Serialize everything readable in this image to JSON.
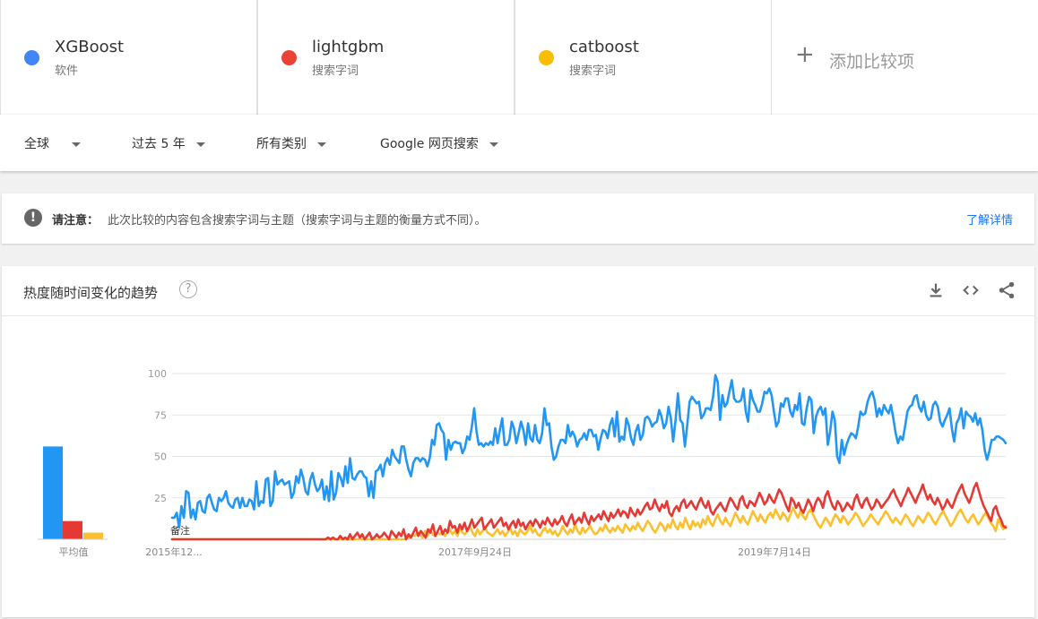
{
  "compare": {
    "terms": [
      {
        "name": "XGBoost",
        "sub": "软件",
        "color": "#4285f4"
      },
      {
        "name": "lightgbm",
        "sub": "搜索字词",
        "color": "#ea4335"
      },
      {
        "name": "catboost",
        "sub": "搜索字词",
        "color": "#fbbc04"
      }
    ],
    "add_label": "添加比较项"
  },
  "filters": {
    "region": "全球",
    "time": "过去 5 年",
    "category": "所有类别",
    "search_type": "Google 网页搜索"
  },
  "notice": {
    "title": "请注意：",
    "text": "此次比较的内容包含搜索字词与主题（搜索字词与主题的衡量方式不同）。",
    "link": "了解详情"
  },
  "card": {
    "title": "热度随时间变化的趋势",
    "icons": [
      "download-icon",
      "embed-code-icon",
      "share-icon"
    ]
  },
  "chart_data": {
    "type": "line",
    "yticks": [
      25,
      50,
      75,
      100
    ],
    "ylim": [
      0,
      100
    ],
    "xtick_labels": [
      "2015年12...",
      "2017年9月24日",
      "2019年7月14日"
    ],
    "note_label": "备注",
    "average_label": "平均值",
    "averages": [
      {
        "name": "XGBoost",
        "value": 56
      },
      {
        "name": "lightgbm",
        "value": 11
      },
      {
        "name": "catboost",
        "value": 4
      }
    ],
    "series": [
      {
        "name": "XGBoost",
        "color": "#2196f3",
        "values": [
          13,
          13,
          16,
          7,
          20,
          13,
          29,
          28,
          13,
          18,
          12,
          22,
          23,
          17,
          16,
          25,
          27,
          22,
          18,
          17,
          25,
          23,
          25,
          29,
          22,
          20,
          19,
          24,
          25,
          19,
          25,
          20,
          20,
          24,
          23,
          18,
          35,
          20,
          23,
          22,
          36,
          37,
          20,
          23,
          41,
          33,
          35,
          36,
          33,
          34,
          35,
          25,
          28,
          38,
          34,
          42,
          37,
          29,
          27,
          36,
          40,
          33,
          29,
          31,
          36,
          24,
          32,
          23,
          41,
          24,
          28,
          40,
          37,
          32,
          44,
          34,
          49,
          37,
          36,
          39,
          41,
          41,
          38,
          37,
          26,
          35,
          25,
          41,
          42,
          45,
          38,
          46,
          49,
          45,
          54,
          50,
          48,
          46,
          56,
          56,
          48,
          42,
          38,
          46,
          49,
          49,
          47,
          49,
          48,
          44,
          49,
          60,
          57,
          69,
          70,
          66,
          64,
          48,
          60,
          54,
          58,
          59,
          58,
          58,
          52,
          55,
          62,
          60,
          68,
          79,
          65,
          57,
          58,
          56,
          58,
          57,
          59,
          57,
          67,
          58,
          66,
          73,
          57,
          57,
          60,
          71,
          67,
          58,
          64,
          71,
          66,
          57,
          70,
          61,
          59,
          69,
          60,
          58,
          64,
          79,
          69,
          70,
          56,
          48,
          50,
          56,
          60,
          60,
          58,
          69,
          62,
          65,
          62,
          56,
          60,
          61,
          64,
          60,
          66,
          66,
          62,
          63,
          54,
          61,
          66,
          65,
          61,
          69,
          73,
          62,
          77,
          59,
          62,
          60,
          73,
          69,
          61,
          57,
          65,
          69,
          60,
          63,
          73,
          74,
          72,
          68,
          70,
          71,
          78,
          74,
          67,
          70,
          80,
          73,
          59,
          72,
          88,
          72,
          70,
          56,
          69,
          83,
          86,
          84,
          82,
          83,
          73,
          75,
          79,
          79,
          78,
          86,
          99,
          95,
          72,
          87,
          80,
          82,
          89,
          96,
          85,
          83,
          83,
          84,
          91,
          77,
          71,
          90,
          84,
          81,
          77,
          77,
          82,
          89,
          88,
          91,
          87,
          77,
          68,
          71,
          82,
          80,
          85,
          85,
          77,
          74,
          81,
          78,
          88,
          70,
          69,
          79,
          86,
          84,
          64,
          74,
          78,
          80,
          75,
          79,
          57,
          65,
          77,
          72,
          50,
          46,
          60,
          51,
          57,
          61,
          64,
          63,
          61,
          68,
          77,
          75,
          76,
          83,
          87,
          89,
          84,
          74,
          79,
          75,
          81,
          78,
          76,
          81,
          73,
          64,
          58,
          62,
          60,
          68,
          77,
          80,
          81,
          86,
          87,
          80,
          77,
          83,
          75,
          72,
          73,
          81,
          83,
          80,
          71,
          68,
          72,
          75,
          79,
          67,
          59,
          70,
          73,
          79,
          67,
          77,
          75,
          74,
          71,
          76,
          69,
          73,
          66,
          54,
          48,
          53,
          60,
          60,
          62,
          62,
          61,
          60,
          58
        ]
      },
      {
        "name": "lightgbm",
        "color": "#e53935",
        "values": [
          0,
          0,
          0,
          0,
          0,
          0,
          0,
          0,
          0,
          0,
          0,
          0,
          0,
          0,
          0,
          0,
          0,
          0,
          0,
          0,
          0,
          0,
          0,
          0,
          0,
          0,
          0,
          0,
          0,
          0,
          0,
          0,
          0,
          0,
          0,
          0,
          0,
          0,
          0,
          0,
          0,
          0,
          0,
          0,
          0,
          0,
          0,
          0,
          0,
          0,
          0,
          0,
          0,
          0,
          0,
          0,
          0,
          0,
          0,
          0,
          0,
          0,
          0,
          0,
          1,
          0,
          1,
          0,
          0,
          2,
          0,
          1,
          0,
          3,
          0,
          2,
          4,
          1,
          3,
          0,
          2,
          4,
          0,
          1,
          3,
          1,
          2,
          4,
          2,
          0,
          5,
          3,
          1,
          4,
          2,
          6,
          0,
          3,
          1,
          4,
          7,
          2,
          5,
          3,
          1,
          6,
          4,
          9,
          2,
          5,
          8,
          3,
          6,
          4,
          11,
          7,
          8,
          4,
          9,
          6,
          10,
          5,
          8,
          12,
          7,
          9,
          11,
          13,
          6,
          8,
          10,
          12,
          7,
          9,
          11,
          13,
          8,
          10,
          6,
          9,
          11,
          7,
          12,
          8,
          10,
          6,
          9,
          11,
          8,
          12,
          10,
          7,
          11,
          9,
          13,
          10,
          8,
          12,
          9,
          11,
          14,
          10,
          8,
          12,
          15,
          9,
          11,
          13,
          10,
          16,
          12,
          9,
          14,
          11,
          13,
          15,
          12,
          17,
          14,
          11,
          16,
          13,
          15,
          18,
          14,
          17,
          16,
          13,
          19,
          16,
          14,
          18,
          15,
          17,
          20,
          22,
          18,
          19,
          24,
          20,
          17,
          21,
          19,
          23,
          16,
          14,
          18,
          20,
          17,
          22,
          24,
          19,
          21,
          23,
          20,
          18,
          22,
          25,
          21,
          19,
          23,
          17,
          15,
          18,
          20,
          22,
          19,
          17,
          21,
          25,
          23,
          20,
          18,
          24,
          26,
          21,
          19,
          23,
          22,
          20,
          24,
          28,
          25,
          21,
          23,
          27,
          24,
          22,
          26,
          30,
          28,
          24,
          20,
          17,
          25,
          23,
          19,
          22,
          18,
          16,
          20,
          24,
          21,
          17,
          22,
          25,
          23,
          19,
          26,
          29,
          24,
          20,
          18,
          23,
          21,
          17,
          19,
          22,
          20,
          18,
          24,
          27,
          22,
          19,
          23,
          25,
          21,
          18,
          20,
          24,
          22,
          19,
          21,
          23,
          25,
          28,
          30,
          26,
          23,
          20,
          24,
          27,
          31,
          28,
          25,
          22,
          26,
          29,
          33,
          28,
          24,
          27,
          23,
          21,
          25,
          22,
          18,
          20,
          24,
          21,
          19,
          23,
          27,
          30,
          33,
          28,
          25,
          22,
          26,
          31,
          34,
          29,
          24,
          20,
          17,
          14,
          11,
          18,
          20,
          15,
          12,
          8,
          7
        ]
      },
      {
        "name": "catboost",
        "color": "#fbc02d",
        "values": [
          0,
          0,
          0,
          0,
          0,
          0,
          0,
          0,
          0,
          0,
          0,
          0,
          0,
          0,
          0,
          0,
          0,
          0,
          0,
          0,
          0,
          0,
          0,
          0,
          0,
          0,
          0,
          0,
          0,
          0,
          0,
          0,
          0,
          0,
          0,
          0,
          0,
          0,
          0,
          0,
          0,
          0,
          0,
          0,
          0,
          0,
          0,
          0,
          0,
          0,
          0,
          0,
          0,
          0,
          0,
          0,
          0,
          0,
          0,
          0,
          0,
          0,
          0,
          0,
          0,
          0,
          0,
          0,
          0,
          0,
          0,
          0,
          0,
          0,
          0,
          0,
          0,
          0,
          0,
          0,
          0,
          0,
          0,
          0,
          0,
          0,
          0,
          0,
          0,
          0,
          0,
          0,
          0,
          0,
          2,
          1,
          3,
          2,
          4,
          3,
          1,
          5,
          2,
          6,
          3,
          2,
          4,
          3,
          5,
          2,
          4,
          6,
          3,
          5,
          2,
          7,
          4,
          3,
          5,
          8,
          4,
          2,
          6,
          3,
          5,
          7,
          4,
          3,
          2,
          4,
          6,
          3,
          5,
          2,
          4,
          7,
          3,
          5,
          2,
          6,
          4,
          3,
          5,
          8,
          4,
          6,
          3,
          2,
          5,
          7,
          4,
          6,
          3,
          5,
          2,
          4,
          8,
          5,
          3,
          6,
          4,
          9,
          5,
          3,
          7,
          4,
          6,
          8,
          5,
          3,
          4,
          7,
          5,
          9,
          6,
          4,
          7,
          5,
          8,
          6,
          4,
          9,
          7,
          5,
          8,
          6,
          10,
          7,
          5,
          8,
          11,
          9,
          6,
          4,
          7,
          10,
          8,
          5,
          9,
          7,
          12,
          8,
          6,
          10,
          7,
          13,
          9,
          6,
          11,
          8,
          10,
          7,
          12,
          9,
          14,
          10,
          8,
          12,
          15,
          11,
          9,
          13,
          10,
          8,
          12,
          16,
          13,
          10,
          14,
          11,
          9,
          13,
          17,
          14,
          11,
          15,
          12,
          10,
          14,
          16,
          13,
          18,
          15,
          12,
          16,
          14,
          11,
          15,
          19,
          16,
          13,
          17,
          14,
          12,
          16,
          18,
          15,
          12,
          9,
          7,
          10,
          13,
          11,
          8,
          12,
          15,
          13,
          10,
          14,
          12,
          9,
          11,
          13,
          16,
          14,
          11,
          8,
          10,
          12,
          15,
          13,
          11,
          9,
          12,
          14,
          17,
          15,
          12,
          10,
          13,
          11,
          9,
          12,
          15,
          13,
          10,
          8,
          11,
          14,
          12,
          10,
          13,
          16,
          14,
          11,
          9,
          12,
          15,
          17,
          14,
          11,
          8,
          10,
          13,
          16,
          18,
          15,
          12,
          10,
          13,
          15,
          12,
          9,
          11,
          14,
          16,
          13,
          10,
          8,
          5,
          12,
          9,
          6,
          8
        ]
      }
    ]
  }
}
